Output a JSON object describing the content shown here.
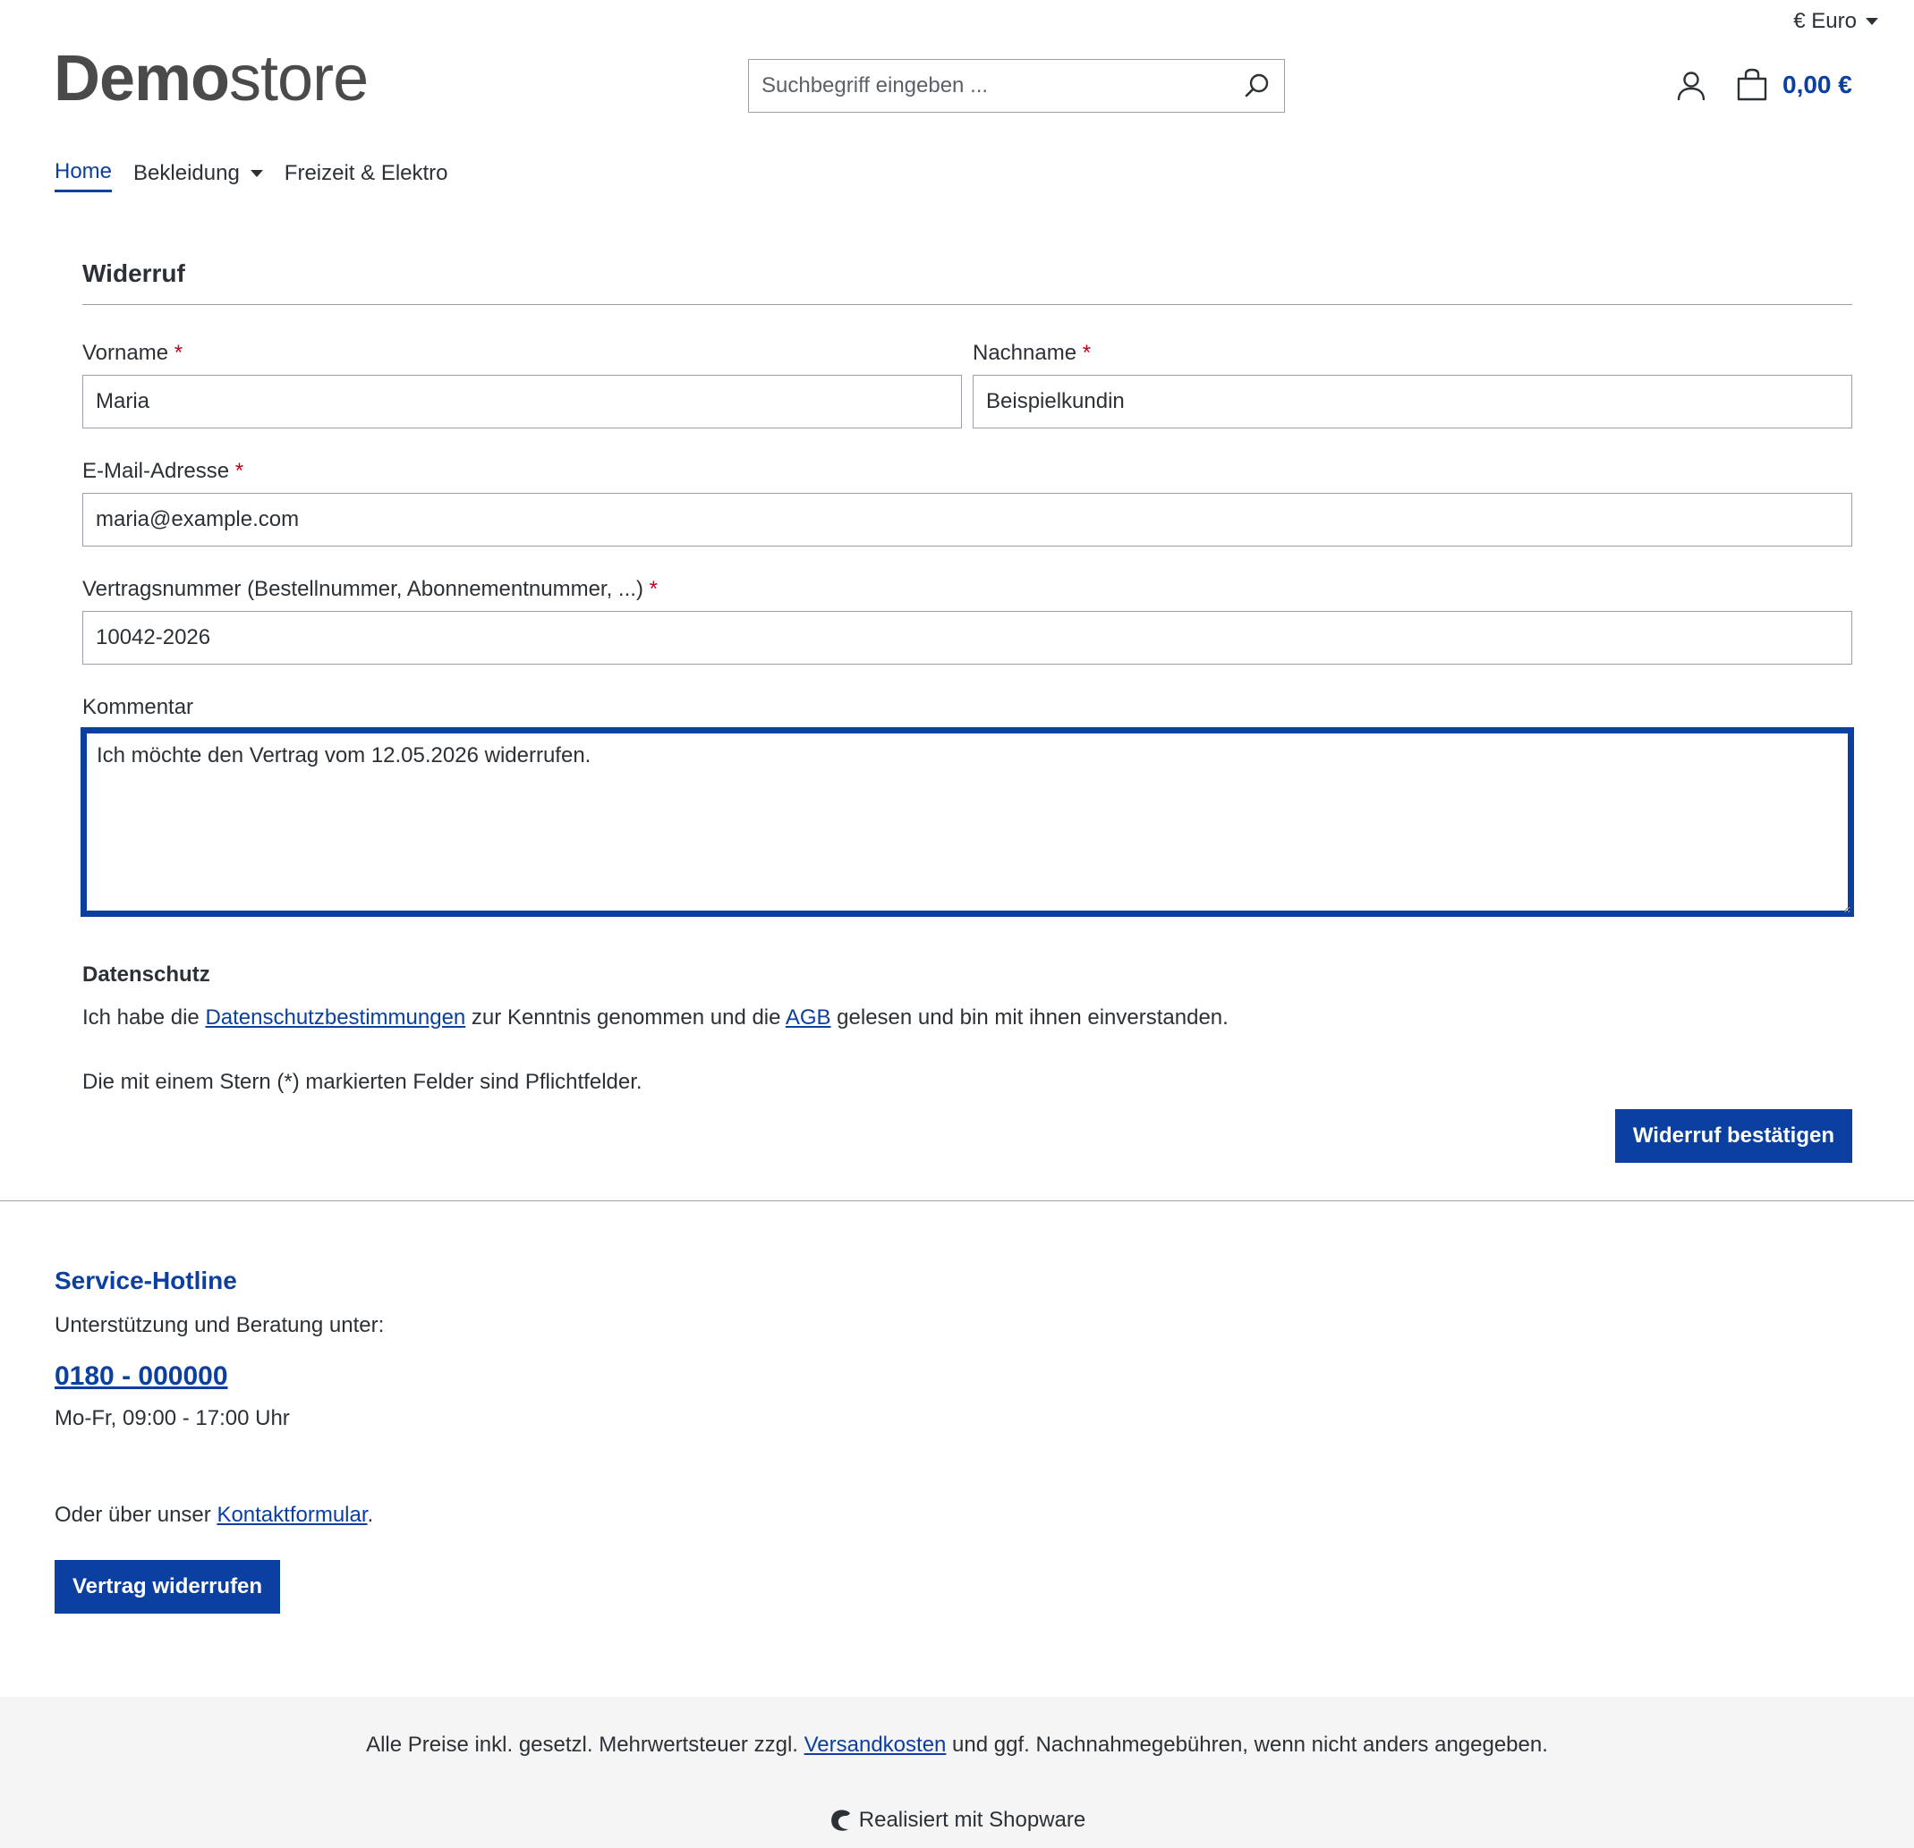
{
  "header": {
    "currency": "€ Euro",
    "logo_bold": "Demo",
    "logo_light": "store",
    "search_placeholder": "Suchbegriff eingeben ...",
    "cart_total": "0,00 €"
  },
  "nav": {
    "items": [
      "Home",
      "Bekleidung",
      "Freizeit & Elektro"
    ]
  },
  "form": {
    "title": "Widerruf",
    "firstname_label": "Vorname",
    "firstname_value": "Maria",
    "lastname_label": "Nachname",
    "lastname_value": "Beispielkundin",
    "email_label": "E-Mail-Adresse",
    "email_value": "maria@example.com",
    "contract_label": "Vertragsnummer (Bestellnummer, Abonnementnummer, ...)",
    "contract_value": "10042-2026",
    "comment_label": "Kommentar",
    "comment_value": "Ich möchte den Vertrag vom 12.05.2026 widerrufen.",
    "required_mark": "*",
    "privacy_heading": "Datenschutz",
    "consent_part1": "Ich habe die ",
    "consent_link1": "Datenschutzbestimmungen",
    "consent_part2": " zur Kenntnis genommen und die ",
    "consent_link2": "AGB",
    "consent_part3": " gelesen und bin mit ihnen einverstanden.",
    "required_note": "Die mit einem Stern (*) markierten Felder sind Pflichtfelder.",
    "submit_label": "Widerruf bestätigen"
  },
  "footer": {
    "service_title": "Service-Hotline",
    "service_text": "Unterstützung und Beratung unter:",
    "hotline": "0180 - 000000",
    "hours": "Mo-Fr, 09:00 - 17:00 Uhr",
    "contact_prefix": "Oder über unser ",
    "contact_link": "Kontaktformular",
    "contact_suffix": ".",
    "revoke_label": "Vertrag widerrufen",
    "vat_part1": "Alle Preise inkl. gesetzl. Mehrwertsteuer zzgl. ",
    "vat_link": "Versandkosten",
    "vat_part2": " und ggf. Nachnahmegebühren, wenn nicht anders angegeben.",
    "powered": "Realisiert mit Shopware"
  },
  "colors": {
    "accent": "#0b3fa0",
    "required": "#c7001d"
  }
}
